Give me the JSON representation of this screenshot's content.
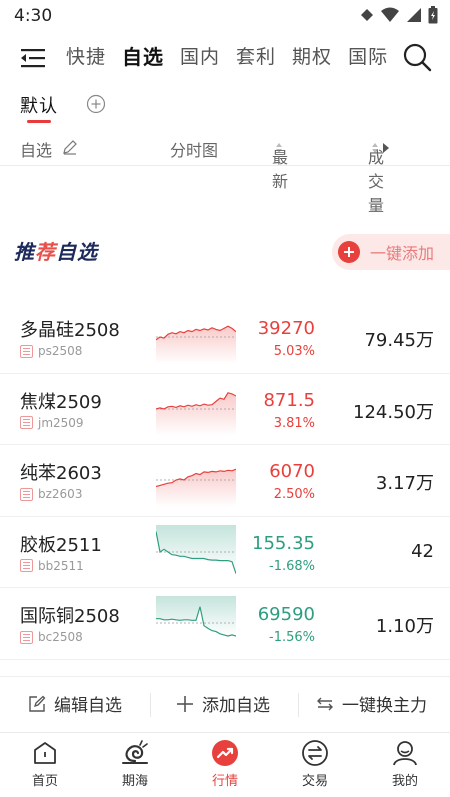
{
  "status_bar": {
    "time": "4:30"
  },
  "top_nav": {
    "tabs": [
      {
        "label": "快捷",
        "active": false
      },
      {
        "label": "自选",
        "active": true
      },
      {
        "label": "国内",
        "active": false
      },
      {
        "label": "套利",
        "active": false
      },
      {
        "label": "期权",
        "active": false
      },
      {
        "label": "国际",
        "active": false
      }
    ]
  },
  "group_bar": {
    "default_label": "默认"
  },
  "columns": {
    "name": "自选",
    "chart": "分时图",
    "latest": "最新",
    "volume": "成交量"
  },
  "recommend": {
    "title_prefix": "推",
    "title_accent": "荐",
    "title_suffix": "自选",
    "add_all_label": "一键添加"
  },
  "rows": [
    {
      "name": "多晶硅2508",
      "code": "ps2508",
      "price": "39270",
      "pct": "5.03%",
      "volume": "79.45万",
      "trend": "up",
      "spark": [
        0.55,
        0.5,
        0.52,
        0.45,
        0.42,
        0.44,
        0.4,
        0.42,
        0.38,
        0.4,
        0.36,
        0.38,
        0.35,
        0.37,
        0.33,
        0.36,
        0.38,
        0.34,
        0.3,
        0.34,
        0.4
      ]
    },
    {
      "name": "焦煤2509",
      "code": "jm2509",
      "price": "871.5",
      "pct": "3.81%",
      "volume": "124.50万",
      "trend": "up",
      "spark": [
        0.5,
        0.48,
        0.5,
        0.46,
        0.45,
        0.47,
        0.44,
        0.46,
        0.43,
        0.45,
        0.42,
        0.44,
        0.41,
        0.43,
        0.42,
        0.36,
        0.3,
        0.32,
        0.2,
        0.22,
        0.26
      ]
    },
    {
      "name": "纯苯2603",
      "code": "bz2603",
      "price": "6070",
      "pct": "2.50%",
      "volume": "3.17万",
      "trend": "up",
      "spark": [
        0.62,
        0.6,
        0.58,
        0.56,
        0.55,
        0.5,
        0.48,
        0.5,
        0.44,
        0.42,
        0.38,
        0.4,
        0.35,
        0.36,
        0.34,
        0.35,
        0.33,
        0.34,
        0.32,
        0.33,
        0.3
      ]
    },
    {
      "name": "胶板2511",
      "code": "bb2511",
      "price": "155.35",
      "pct": "-1.68%",
      "volume": "42",
      "trend": "down",
      "spark": [
        0.12,
        0.5,
        0.45,
        0.5,
        0.55,
        0.56,
        0.58,
        0.58,
        0.6,
        0.62,
        0.62,
        0.62,
        0.62,
        0.64,
        0.65,
        0.65,
        0.66,
        0.66,
        0.66,
        0.68,
        0.9
      ]
    },
    {
      "name": "国际铜2508",
      "code": "bc2508",
      "price": "69590",
      "pct": "-1.56%",
      "volume": "1.10万",
      "trend": "down",
      "spark": [
        0.42,
        0.42,
        0.44,
        0.44,
        0.43,
        0.44,
        0.45,
        0.44,
        0.44,
        0.45,
        0.45,
        0.2,
        0.55,
        0.6,
        0.64,
        0.66,
        0.7,
        0.72,
        0.74,
        0.72,
        0.74
      ]
    }
  ],
  "action_bar": {
    "edit_label": "编辑自选",
    "add_label": "添加自选",
    "switch_label": "一键换主力"
  },
  "bottom_nav": [
    {
      "label": "首页",
      "icon": "home-icon",
      "active": false
    },
    {
      "label": "期海",
      "icon": "snail-icon",
      "active": false
    },
    {
      "label": "行情",
      "icon": "market-trend-icon",
      "active": true
    },
    {
      "label": "交易",
      "icon": "trade-exchange-icon",
      "active": false
    },
    {
      "label": "我的",
      "icon": "profile-icon",
      "active": false
    }
  ],
  "colors": {
    "up": "#e8403c",
    "down": "#2e9e7f",
    "accent": "#e8403c",
    "brand_navy": "#1d2a5c"
  }
}
